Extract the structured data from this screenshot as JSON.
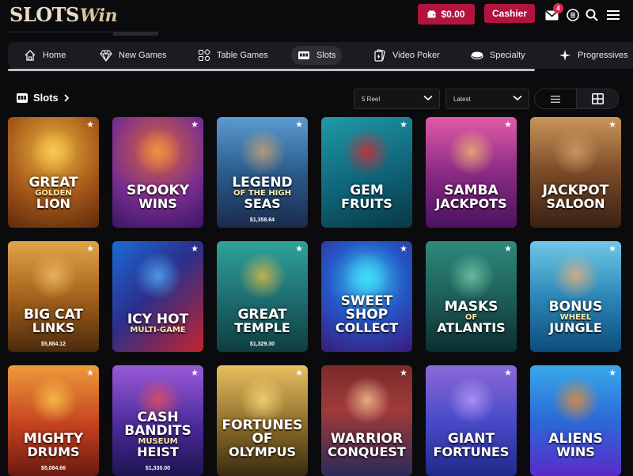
{
  "header": {
    "logo_main": "SLOTS",
    "logo_script": "Win",
    "balance": "$0.00",
    "cashier_label": "Cashier",
    "mail_badge": "4",
    "icons": [
      "wallet-icon",
      "mail-icon",
      "list-icon",
      "search-icon",
      "menu-icon"
    ]
  },
  "nav": {
    "items": [
      {
        "label": "Home",
        "icon": "home-icon"
      },
      {
        "label": "New Games",
        "icon": "diamond-icon"
      },
      {
        "label": "Table Games",
        "icon": "cards-icon"
      },
      {
        "label": "Slots",
        "icon": "slot-machine-icon",
        "active": true
      },
      {
        "label": "Video Poker",
        "icon": "poker-card-icon"
      },
      {
        "label": "Specialty",
        "icon": "specialty-icon"
      },
      {
        "label": "Progressives",
        "icon": "sparkle-icon"
      }
    ]
  },
  "section": {
    "title": "Slots",
    "filter_reel": "5 Reel",
    "filter_sort": "Latest"
  },
  "games": [
    {
      "l1": "GREAT",
      "l2": "GOLDEN",
      "l3": "LION",
      "jackpot": ""
    },
    {
      "l1": "SPOOKY",
      "l2": "",
      "l3": "WINS",
      "jackpot": ""
    },
    {
      "l1": "LEGEND",
      "l2": "OF THE HIGH",
      "l3": "SEAS",
      "jackpot": "$1,358.64"
    },
    {
      "l1": "GEM",
      "l2": "",
      "l3": "FRUITS",
      "jackpot": ""
    },
    {
      "l1": "SAMBA",
      "l2": "",
      "l3": "JACKPOTS",
      "jackpot": ""
    },
    {
      "l1": "JACKPOT",
      "l2": "",
      "l3": "SALOON",
      "jackpot": ""
    },
    {
      "l1": "BIG CAT",
      "l2": "",
      "l3": "LINKS",
      "jackpot": "$5,884.12"
    },
    {
      "l1": "ICY HOT",
      "l2": "MULTI-GAME",
      "l3": "",
      "jackpot": ""
    },
    {
      "l1": "GREAT",
      "l2": "",
      "l3": "TEMPLE",
      "jackpot": "$1,329.30"
    },
    {
      "l1": "SWEET SHOP",
      "l2": "",
      "l3": "COLLECT",
      "jackpot": ""
    },
    {
      "l1": "MASKS",
      "l2": "OF",
      "l3": "ATLANTIS",
      "jackpot": ""
    },
    {
      "l1": "BONUS",
      "l2": "WHEEL",
      "l3": "JUNGLE",
      "jackpot": ""
    },
    {
      "l1": "MIGHTY",
      "l2": "",
      "l3": "DRUMS",
      "jackpot": "$5,084.66"
    },
    {
      "l1": "CASH BANDITS",
      "l2": "MUSEUM",
      "l3": "HEIST",
      "jackpot": "$1,330.00"
    },
    {
      "l1": "FORTUNES OF",
      "l2": "",
      "l3": "OLYMPUS",
      "jackpot": ""
    },
    {
      "l1": "WARRIOR",
      "l2": "",
      "l3": "CONQUEST",
      "jackpot": ""
    },
    {
      "l1": "GIANT",
      "l2": "",
      "l3": "FORTUNES",
      "jackpot": ""
    },
    {
      "l1": "ALIENS",
      "l2": "",
      "l3": "WINS",
      "jackpot": ""
    }
  ],
  "colors": {
    "accent": "#b2133f",
    "background": "#0b0b0d",
    "nav_bg": "#1c1c20"
  }
}
